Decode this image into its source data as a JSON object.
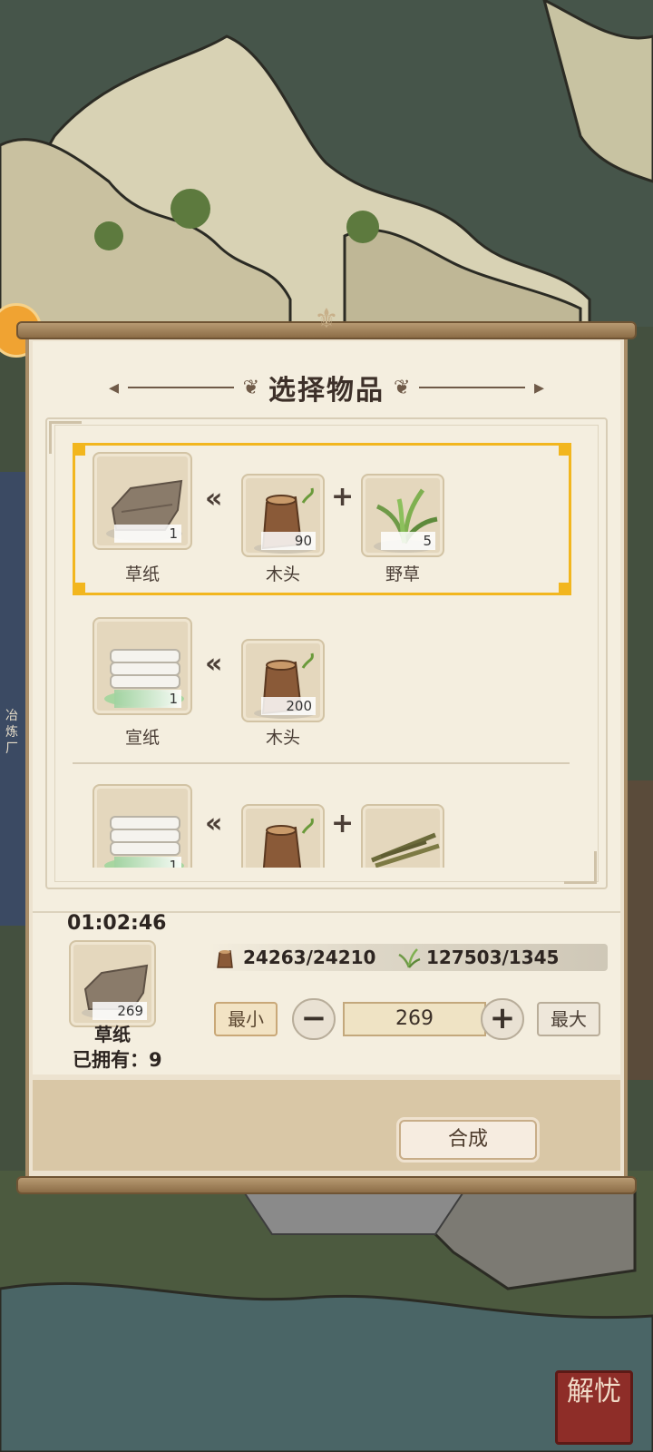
{
  "dialog": {
    "title": "选择物品"
  },
  "recipes": [
    {
      "result": {
        "name": "草纸",
        "count": "1",
        "icon": "coarse-paper-icon"
      },
      "ingredients": [
        {
          "name": "木头",
          "count": "90",
          "icon": "wood-log-icon"
        },
        {
          "name": "野草",
          "count": "5",
          "icon": "wild-grass-icon"
        }
      ],
      "selected": true
    },
    {
      "result": {
        "name": "宣纸",
        "count": "1",
        "icon": "rice-paper-icon"
      },
      "ingredients": [
        {
          "name": "木头",
          "count": "200",
          "icon": "wood-log-icon"
        }
      ],
      "selected": false
    },
    {
      "result": {
        "name": "",
        "count": "1",
        "icon": "rice-paper-icon"
      },
      "ingredients": [
        {
          "name": "",
          "count": "",
          "icon": "wood-log-icon"
        },
        {
          "name": "",
          "count": "",
          "icon": "twigs-icon"
        }
      ],
      "selected": false
    }
  ],
  "craft": {
    "timer": "01:02:46",
    "selected_item": {
      "name": "草纸",
      "count": "269",
      "icon": "coarse-paper-icon"
    },
    "owned_label": "已拥有：9",
    "resources": [
      {
        "icon": "wood-log-icon",
        "text": "24263/24210"
      },
      {
        "icon": "wild-grass-icon",
        "text": "127503/1345"
      }
    ],
    "min_label": "最小",
    "max_label": "最大",
    "quantity": "269",
    "craft_label": "合成"
  },
  "map": {
    "side_label": "冶炼厂",
    "seal_text": "解忧"
  },
  "colors": {
    "selection": "#f2b61e",
    "panel": "#f4eedf",
    "text_dark": "#2d2521"
  }
}
